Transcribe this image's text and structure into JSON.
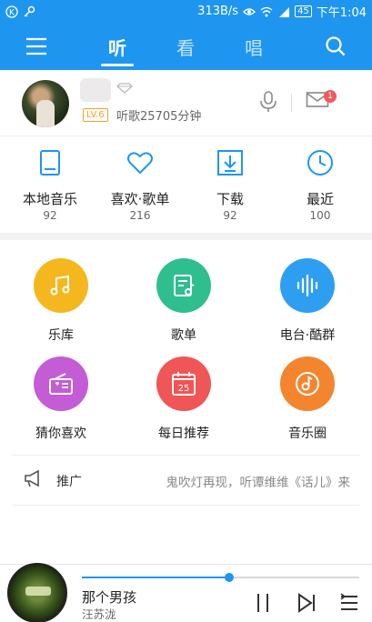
{
  "status_bar": {
    "speed": "313B/s",
    "battery": "45",
    "time": "下午1:04"
  },
  "nav": {
    "tabs": [
      {
        "label": "听",
        "active": true
      },
      {
        "label": "看",
        "active": false
      },
      {
        "label": "唱",
        "active": false
      }
    ],
    "menu_icon": "menu-icon",
    "search_icon": "search-icon"
  },
  "profile": {
    "level": "LV.6",
    "listen_time": "听歌25705分钟",
    "mail_badge": "1"
  },
  "quick_entries": [
    {
      "label": "本地音乐",
      "count": "92",
      "icon": "phone-icon"
    },
    {
      "label": "喜欢·歌单",
      "count": "216",
      "icon": "heart-icon"
    },
    {
      "label": "下载",
      "count": "92",
      "icon": "download-icon"
    },
    {
      "label": "最近",
      "count": "100",
      "icon": "clock-icon"
    }
  ],
  "features": [
    {
      "label": "乐库",
      "color": "#f4b81e",
      "icon": "music-note-icon"
    },
    {
      "label": "歌单",
      "color": "#2fbf8e",
      "icon": "playlist-icon"
    },
    {
      "label": "电台·酷群",
      "color": "#2e9ff0",
      "icon": "soundwave-icon"
    },
    {
      "label": "猜你喜欢",
      "color": "#c45cd6",
      "icon": "radio-icon"
    },
    {
      "label": "每日推荐",
      "color": "#ef5655",
      "icon": "calendar-icon"
    },
    {
      "label": "音乐圈",
      "color": "#f3852e",
      "icon": "music-circle-icon"
    }
  ],
  "calendar_day": "25",
  "promo": {
    "tag": "推广",
    "text": "鬼吹灯再现，听谭维维《话儿》来"
  },
  "player": {
    "song": "那个男孩",
    "artist": "汪苏泷",
    "progress": 0.53
  },
  "colors": {
    "accent": "#1e96f0"
  }
}
